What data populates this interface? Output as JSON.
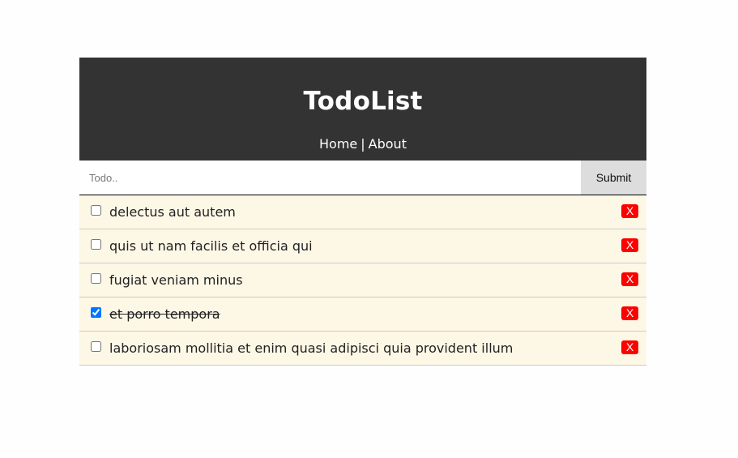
{
  "header": {
    "title": "TodoList",
    "nav": {
      "home": "Home",
      "separator": "|",
      "about": "About"
    }
  },
  "form": {
    "placeholder": "Todo..",
    "value": "",
    "submit_label": "Submit"
  },
  "todos": [
    {
      "title": "delectus aut autem",
      "completed": false,
      "delete_label": "X"
    },
    {
      "title": "quis ut nam facilis et officia qui",
      "completed": false,
      "delete_label": "X"
    },
    {
      "title": "fugiat veniam minus",
      "completed": false,
      "delete_label": "X"
    },
    {
      "title": "et porro tempora",
      "completed": true,
      "delete_label": "X"
    },
    {
      "title": "laboriosam mollitia et enim quasi adipisci quia provident illum",
      "completed": false,
      "delete_label": "X"
    }
  ],
  "colors": {
    "header_bg": "#333333",
    "item_bg": "#fdf7e6",
    "delete_bg": "#ff0000",
    "submit_bg": "#dddddd"
  }
}
